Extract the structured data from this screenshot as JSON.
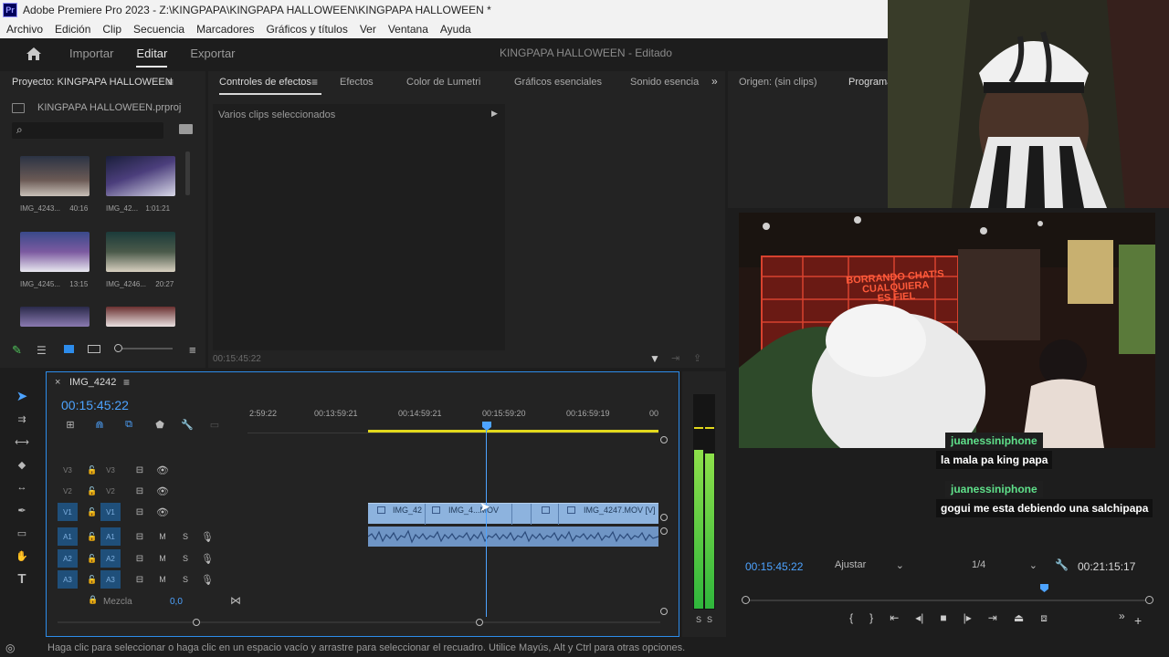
{
  "app": {
    "logo": "Pr",
    "title": "Adobe Premiere Pro 2023 - Z:\\KINGPAPA\\KINGPAPA HALLOWEEN\\KINGPAPA HALLOWEEN *"
  },
  "menu": [
    "Archivo",
    "Edición",
    "Clip",
    "Secuencia",
    "Marcadores",
    "Gráficos y títulos",
    "Ver",
    "Ventana",
    "Ayuda"
  ],
  "workspace": {
    "tabs": [
      "Importar",
      "Editar",
      "Exportar"
    ],
    "active": "Editar",
    "project_name": "KINGPAPA HALLOWEEN",
    "project_state": "- Editado"
  },
  "project_panel": {
    "title": "Proyecto: KINGPAPA HALLOWEEN",
    "file": "KINGPAPA HALLOWEEN.prproj",
    "search_placeholder": "",
    "items": [
      {
        "name": "IMG_4243...",
        "duration": "40:16"
      },
      {
        "name": "IMG_42...",
        "duration": "1:01:21"
      },
      {
        "name": "IMG_4245...",
        "duration": "13:15"
      },
      {
        "name": "IMG_4246...",
        "duration": "20:27"
      }
    ]
  },
  "effects_panel": {
    "tabs": [
      "Controles de efectos",
      "Efectos",
      "Color de Lumetri",
      "Gráficos esenciales",
      "Sonido esencia"
    ],
    "active_tab": "Controles de efectos",
    "message": "Varios clips seleccionados",
    "timecode": "00:15:45:22"
  },
  "source_panel": {
    "tabs": [
      "Origen: (sin clips)",
      "Programa"
    ]
  },
  "timeline": {
    "sequence": "IMG_4242",
    "timecode": "00:15:45:22",
    "ruler": [
      "2:59:22",
      "00:13:59:21",
      "00:14:59:21",
      "00:15:59:20",
      "00:16:59:19",
      "00"
    ],
    "video_tracks": [
      {
        "label": "V3",
        "toggle": "V3"
      },
      {
        "label": "V2",
        "toggle": "V2"
      },
      {
        "label": "V1",
        "toggle": "V1"
      }
    ],
    "audio_tracks": [
      {
        "label": "A1",
        "toggle": "A1",
        "m": "M",
        "s": "S"
      },
      {
        "label": "A2",
        "toggle": "A2",
        "m": "M",
        "s": "S"
      },
      {
        "label": "A3",
        "toggle": "A3",
        "m": "M",
        "s": "S"
      }
    ],
    "mix_label": "Mezcla",
    "mix_value": "0,0",
    "clips": [
      "IMG_42",
      "IMG_4...MOV",
      "IMG_4247.MOV [V]"
    ]
  },
  "program_monitor": {
    "timecode": "00:15:45:22",
    "fit": "Ajustar",
    "resolution": "1/4",
    "duration": "00:21:15:17",
    "meter_labels": [
      "S",
      "S"
    ]
  },
  "chat": [
    {
      "user": "juanessiniphone",
      "message": "la mala pa king papa"
    },
    {
      "user": "juanessiniphone",
      "message": "gogui me esta debiendo una salchipapa"
    }
  ],
  "video_sign": {
    "line1": "BORRANDO CHAT'S",
    "line2": "CUALQUIERA",
    "line3": "ES FIEL"
  },
  "status_text": "Haga clic para seleccionar o haga clic en un espacio vacío y arrastre para seleccionar el recuadro. Utilice Mayús, Alt y Ctrl para otras opciones.",
  "colors": {
    "accent": "#2d8ceb",
    "timecode": "#4da3ff",
    "clip": "#8db3de",
    "chat_name": "#5fe08a"
  }
}
